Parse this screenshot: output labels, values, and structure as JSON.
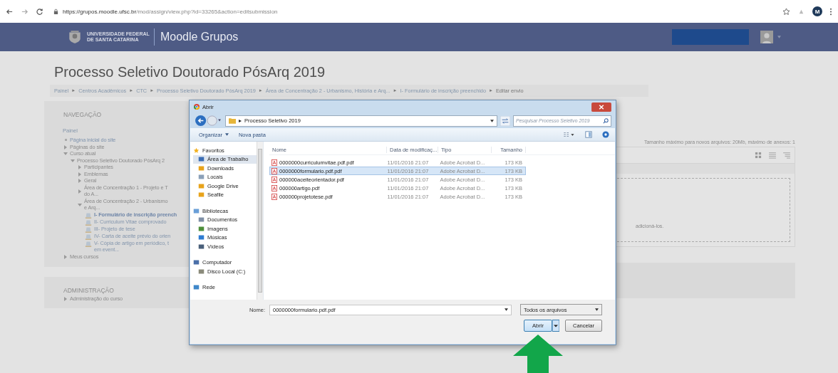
{
  "browser": {
    "url_host": "https://grupos.moodle.ufsc.br",
    "url_path": "/mod/assign/view.php?id=33265&action=editsubmission",
    "profile_initial": "M"
  },
  "header": {
    "logo_line1": "UNIVERSIDADE FEDERAL",
    "logo_line2": "DE SANTA CATARINA",
    "site_name": "Moodle Grupos"
  },
  "page": {
    "title": "Processo Seletivo Doutorado PósArq 2019",
    "breadcrumb_separator": "►",
    "breadcrumb": [
      "Painel",
      "Centros Acadêmicos",
      "CTC",
      "Processo Seletivo Doutorado PósArq 2019",
      "Área de Concentração 2 - Urbanismo, História e Arq...",
      "I- Formulário de inscrição preenchido",
      "Editar envio"
    ]
  },
  "navigation": {
    "title": "NAVEGAÇÃO",
    "root": "Painel",
    "items": [
      {
        "label": "Página inicial do site",
        "kind": "bullet"
      },
      {
        "label": "Páginas do site",
        "kind": "branch",
        "expanded": false
      },
      {
        "label": "Curso atual",
        "kind": "branch",
        "expanded": true,
        "children": [
          {
            "label": "Processo Seletivo Doutorado PósArq 2",
            "kind": "branch",
            "expanded": true,
            "children": [
              {
                "label": "Participantes",
                "kind": "branch",
                "expanded": false
              },
              {
                "label": "Emblemas",
                "kind": "branch",
                "expanded": false
              },
              {
                "label": "Geral",
                "kind": "branch",
                "expanded": false
              },
              {
                "label": "Área de Concentração 1 - Projeto e T",
                "label_2": "do A...",
                "kind": "branch",
                "expanded": false
              },
              {
                "label": "Área de Concentração 2 - Urbanismo",
                "label_2": "e Arq...",
                "kind": "branch",
                "expanded": true,
                "children": [
                  {
                    "label": "I- Formulário de inscrição preench",
                    "kind": "activity",
                    "current": true
                  },
                  {
                    "label": "II- Curriculum Vitae comprovado",
                    "kind": "activity",
                    "current": false
                  },
                  {
                    "label": "III- Projeto de tese",
                    "kind": "activity",
                    "current": false
                  },
                  {
                    "label": "IV- Carta de aceite prévio do orien",
                    "kind": "activity",
                    "current": false
                  },
                  {
                    "label": "V- Cópia de artigo em periódico, t",
                    "label_2": "em event...",
                    "kind": "activity",
                    "current": false
                  }
                ]
              }
            ]
          }
        ]
      },
      {
        "label": "Meus cursos",
        "kind": "branch",
        "expanded": false
      }
    ]
  },
  "administration": {
    "title": "ADMINISTRAÇÃO",
    "items": [
      {
        "label": "Administração do curso",
        "kind": "branch",
        "expanded": false
      }
    ]
  },
  "filemanager": {
    "limits": "Tamanho máximo para novos arquivos: 20Mb, máximo de anexos: 1",
    "drop_hint": "adicioná-los."
  },
  "dialog": {
    "title": "Abrir",
    "path_separator": "▸",
    "path": "Processo Seletivo 2019",
    "search_placeholder": "Pesquisar Processo Seletivo 2019",
    "toolbar": [
      "Organizar",
      "Nova pasta"
    ],
    "sidebar": [
      {
        "label": "Favoritos",
        "items": [
          {
            "label": "Área de Trabalho",
            "selected": true
          },
          {
            "label": "Downloads",
            "selected": false
          },
          {
            "label": "Locais",
            "selected": false
          },
          {
            "label": "Google Drive",
            "selected": false
          },
          {
            "label": "Seafile",
            "selected": false
          }
        ]
      },
      {
        "label": "Bibliotecas",
        "items": [
          {
            "label": "Documentos",
            "selected": false
          },
          {
            "label": "Imagens",
            "selected": false
          },
          {
            "label": "Músicas",
            "selected": false
          },
          {
            "label": "Vídeos",
            "selected": false
          }
        ]
      },
      {
        "label": "Computador",
        "items": [
          {
            "label": "Disco Local (C:)",
            "selected": false
          }
        ]
      },
      {
        "label": "Rede"
      }
    ],
    "columns": [
      "Nome",
      "Data de modificaç...",
      "Tipo",
      "Tamanho"
    ],
    "files": [
      {
        "name": "0000000curriculumvitae.pdf.pdf",
        "date": "11/01/2016 21:07",
        "type": "Adobe Acrobat D...",
        "size": "173 KB",
        "selected": false
      },
      {
        "name": "0000000formulario.pdf.pdf",
        "date": "11/01/2016 21:07",
        "type": "Adobe Acrobat D...",
        "size": "173 KB",
        "selected": true
      },
      {
        "name": "000000aceiteorientador.pdf",
        "date": "11/01/2016 21:07",
        "type": "Adobe Acrobat D...",
        "size": "173 KB",
        "selected": false
      },
      {
        "name": "000000artigo.pdf",
        "date": "11/01/2016 21:07",
        "type": "Adobe Acrobat D...",
        "size": "173 KB",
        "selected": false
      },
      {
        "name": "000000projetotese.pdf",
        "date": "11/01/2016 21:07",
        "type": "Adobe Acrobat D...",
        "size": "173 KB",
        "selected": false
      }
    ],
    "name_label": "Nome:",
    "name_value": "0000000formulario.pdf.pdf",
    "filter": "Todos os arquivos",
    "open_button": "Abrir",
    "cancel_button": "Cancelar"
  }
}
